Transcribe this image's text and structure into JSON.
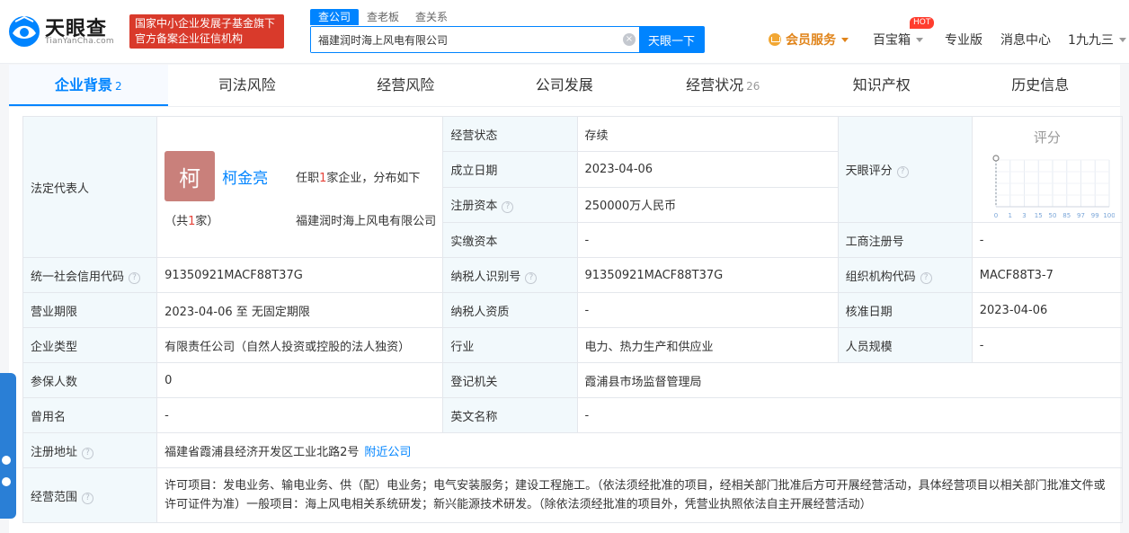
{
  "header": {
    "logo_text": "天眼查",
    "logo_sub": "TianYanCha.com",
    "badge_line1": "国家中小企业发展子基金旗下",
    "badge_line2": "官方备案企业征信机构",
    "search_tabs": [
      "查公司",
      "查老板",
      "查关系"
    ],
    "search_value": "福建润时海上风电有限公司",
    "search_button": "天眼一下",
    "member": "会员服务",
    "baibao": "百宝箱",
    "hot": "HOT",
    "pro": "专业版",
    "messages": "消息中心",
    "user": "1九九三"
  },
  "tabs": [
    {
      "label": "企业背景",
      "count": "2"
    },
    {
      "label": "司法风险",
      "count": ""
    },
    {
      "label": "经营风险",
      "count": ""
    },
    {
      "label": "公司发展",
      "count": ""
    },
    {
      "label": "经营状况",
      "count": "26"
    },
    {
      "label": "知识产权",
      "count": ""
    },
    {
      "label": "历史信息",
      "count": ""
    }
  ],
  "rep": {
    "label": "法定代表人",
    "avatar_char": "柯",
    "name": "柯金亮",
    "count_prefix": "（共",
    "count_num": "1",
    "count_suffix": "家）",
    "post_prefix": "任职",
    "post_num": "1",
    "post_suffix": "家企业，分布如下",
    "company": "福建润时海上风电有限公司"
  },
  "fields": {
    "status_label": "经营状态",
    "status_value": "存续",
    "founded_label": "成立日期",
    "founded_value": "2023-04-06",
    "capital_label": "注册资本",
    "capital_value": "250000万人民币",
    "paid_label": "实缴资本",
    "paid_value": "-",
    "score_label": "天眼评分",
    "score_title": "评分",
    "reg_no_label": "工商注册号",
    "reg_no_value": "-",
    "credit_label": "统一社会信用代码",
    "credit_value": "91350921MACF88T37G",
    "tax_label": "纳税人识别号",
    "tax_value": "91350921MACF88T37G",
    "org_label": "组织机构代码",
    "org_value": "MACF88T3-7",
    "term_label": "营业期限",
    "term_value": "2023-04-06 至 无固定期限",
    "tax_qual_label": "纳税人资质",
    "tax_qual_value": "-",
    "approve_label": "核准日期",
    "approve_value": "2023-04-06",
    "type_label": "企业类型",
    "type_value": "有限责任公司（自然人投资或控股的法人独资）",
    "industry_label": "行业",
    "industry_value": "电力、热力生产和供应业",
    "staff_label": "人员规模",
    "staff_value": "-",
    "insured_label": "参保人数",
    "insured_value": "0",
    "authority_label": "登记机关",
    "authority_value": "霞浦县市场监督管理局",
    "former_label": "曾用名",
    "former_value": "-",
    "en_label": "英文名称",
    "en_value": "-",
    "address_label": "注册地址",
    "address_value": "福建省霞浦县经济开发区工业北路2号",
    "address_link": "附近公司",
    "scope_label": "经营范围",
    "scope_value": "许可项目：发电业务、输电业务、供（配）电业务；电气安装服务；建设工程施工。（依法须经批准的项目，经相关部门批准后方可开展经营活动，具体经营项目以相关部门批准文件或许可证件为准）一般项目：海上风电相关系统研发；新兴能源技术研发。（除依法须经批准的项目外，凭营业执照依法自主开展经营活动）"
  },
  "chart_data": {
    "type": "line",
    "title": "评分",
    "x": [
      "0",
      "1",
      "3",
      "15",
      "50",
      "85",
      "97",
      "99",
      "100"
    ],
    "marker_x": "0"
  }
}
